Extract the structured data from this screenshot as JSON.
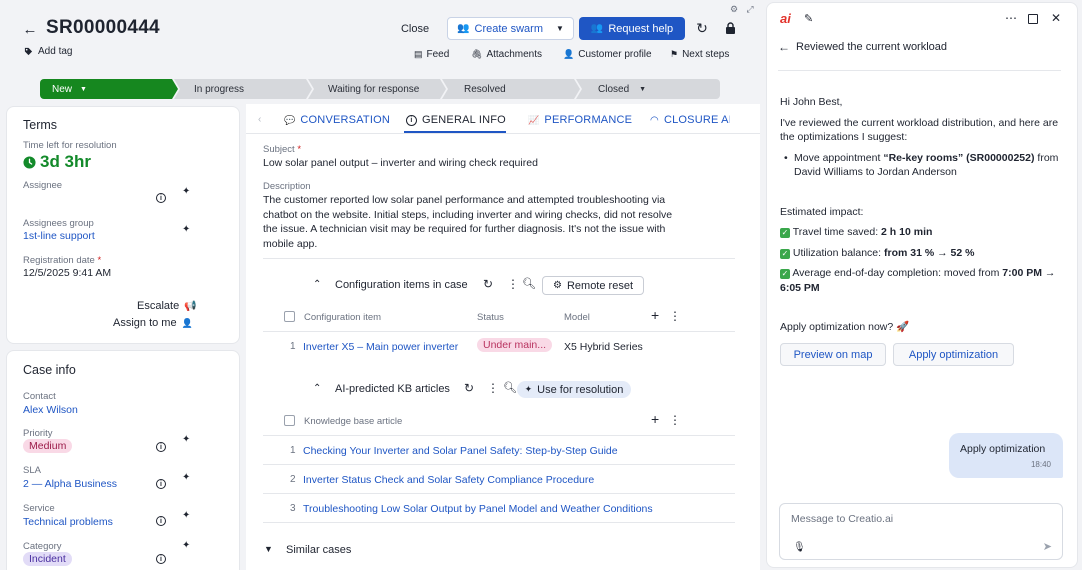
{
  "header": {
    "case_id": "SR00000444",
    "add_tag": "Add tag",
    "close": "Close",
    "create_swarm": "Create swarm",
    "request_help": "Request help",
    "feed": "Feed",
    "attachments": "Attachments",
    "customer_profile": "Customer profile",
    "next_steps": "Next steps"
  },
  "stages": [
    "New",
    "In progress",
    "Waiting for response",
    "Resolved",
    "Closed"
  ],
  "terms": {
    "title": "Terms",
    "time_left_label": "Time left for resolution",
    "time_left_value": "3d 3hr",
    "assignee_label": "Assignee",
    "assignees_group_label": "Assignees group",
    "assignees_group_value": "1st-line support",
    "registration_label": "Registration date",
    "registration_value": "12/5/2025 9:41 AM",
    "escalate": "Escalate",
    "assign_to_me": "Assign to me"
  },
  "case_info": {
    "title": "Case info",
    "contact_label": "Contact",
    "contact_value": "Alex Wilson",
    "priority_label": "Priority",
    "priority_value": "Medium",
    "sla_label": "SLA",
    "sla_value": "2 — Alpha Business",
    "service_label": "Service",
    "service_value": "Technical problems",
    "category_label": "Category",
    "category_value": "Incident"
  },
  "tabs": [
    "CONVERSATION",
    "GENERAL INFO",
    "PERFORMANCE",
    "CLOSURE AI"
  ],
  "general": {
    "subject_label": "Subject",
    "subject_value": "Low solar panel output – inverter and wiring check required",
    "description_label": "Description",
    "description_value": "The customer reported low solar panel performance and attempted troubleshooting via chatbot on the website. Initial steps, including inverter and wiring checks, did not resolve the issue. A technician visit may be required for further diagnosis. It's not the issue with mobile app."
  },
  "config_items": {
    "title": "Configuration items in case",
    "remote_reset": "Remote reset",
    "columns": [
      "Configuration item",
      "Status",
      "Model"
    ],
    "rows": [
      {
        "num": "1",
        "item": "Inverter X5 – Main power inverter",
        "status": "Under main...",
        "model": "X5 Hybrid Series"
      }
    ]
  },
  "kb": {
    "title": "AI-predicted KB articles",
    "use_for_resolution": "Use for resolution",
    "column": "Knowledge base article",
    "rows": [
      {
        "num": "1",
        "title": "Checking Your Inverter and Solar Panel Safety: Step-by-Step Guide"
      },
      {
        "num": "2",
        "title": "Inverter Status Check and Solar Safety Compliance Procedure"
      },
      {
        "num": "3",
        "title": "Troubleshooting Low Solar Output by Panel Model and Weather Conditions"
      }
    ]
  },
  "similar_cases": "Similar cases",
  "chat": {
    "header_title": "Reviewed the current workload",
    "greeting": "Hi John Best,",
    "intro": "I've reviewed the current workload distribution, and here are the optimizations I suggest:",
    "bullet_prefix": "Move appointment ",
    "bullet_bold": "“Re-key rooms” (SR00000252)",
    "bullet_suffix": " from David Williams to Jordan Anderson",
    "impact_title": "Estimated impact:",
    "impact1_label": "Travel time saved: ",
    "impact1_value": "2 h 10 min",
    "impact2_label": "Utilization balance: ",
    "impact2_value": "from 31 % → 52 %",
    "impact3_label": "Average end-of-day completion: moved from ",
    "impact3_value": "7:00 PM → 6:05 PM",
    "question": "Apply optimization now? 🚀",
    "preview_btn": "Preview on map",
    "apply_btn": "Apply optimization",
    "user_msg": "Apply optimization",
    "user_time": "18:40",
    "input_placeholder": "Message to Creatio.ai"
  },
  "colors": {
    "accent": "#1f56c4",
    "stage_active": "#16871f",
    "time_left": "#138a2a",
    "priority_bg": "#f9d9e6",
    "category_bg": "#e2dcf7"
  }
}
